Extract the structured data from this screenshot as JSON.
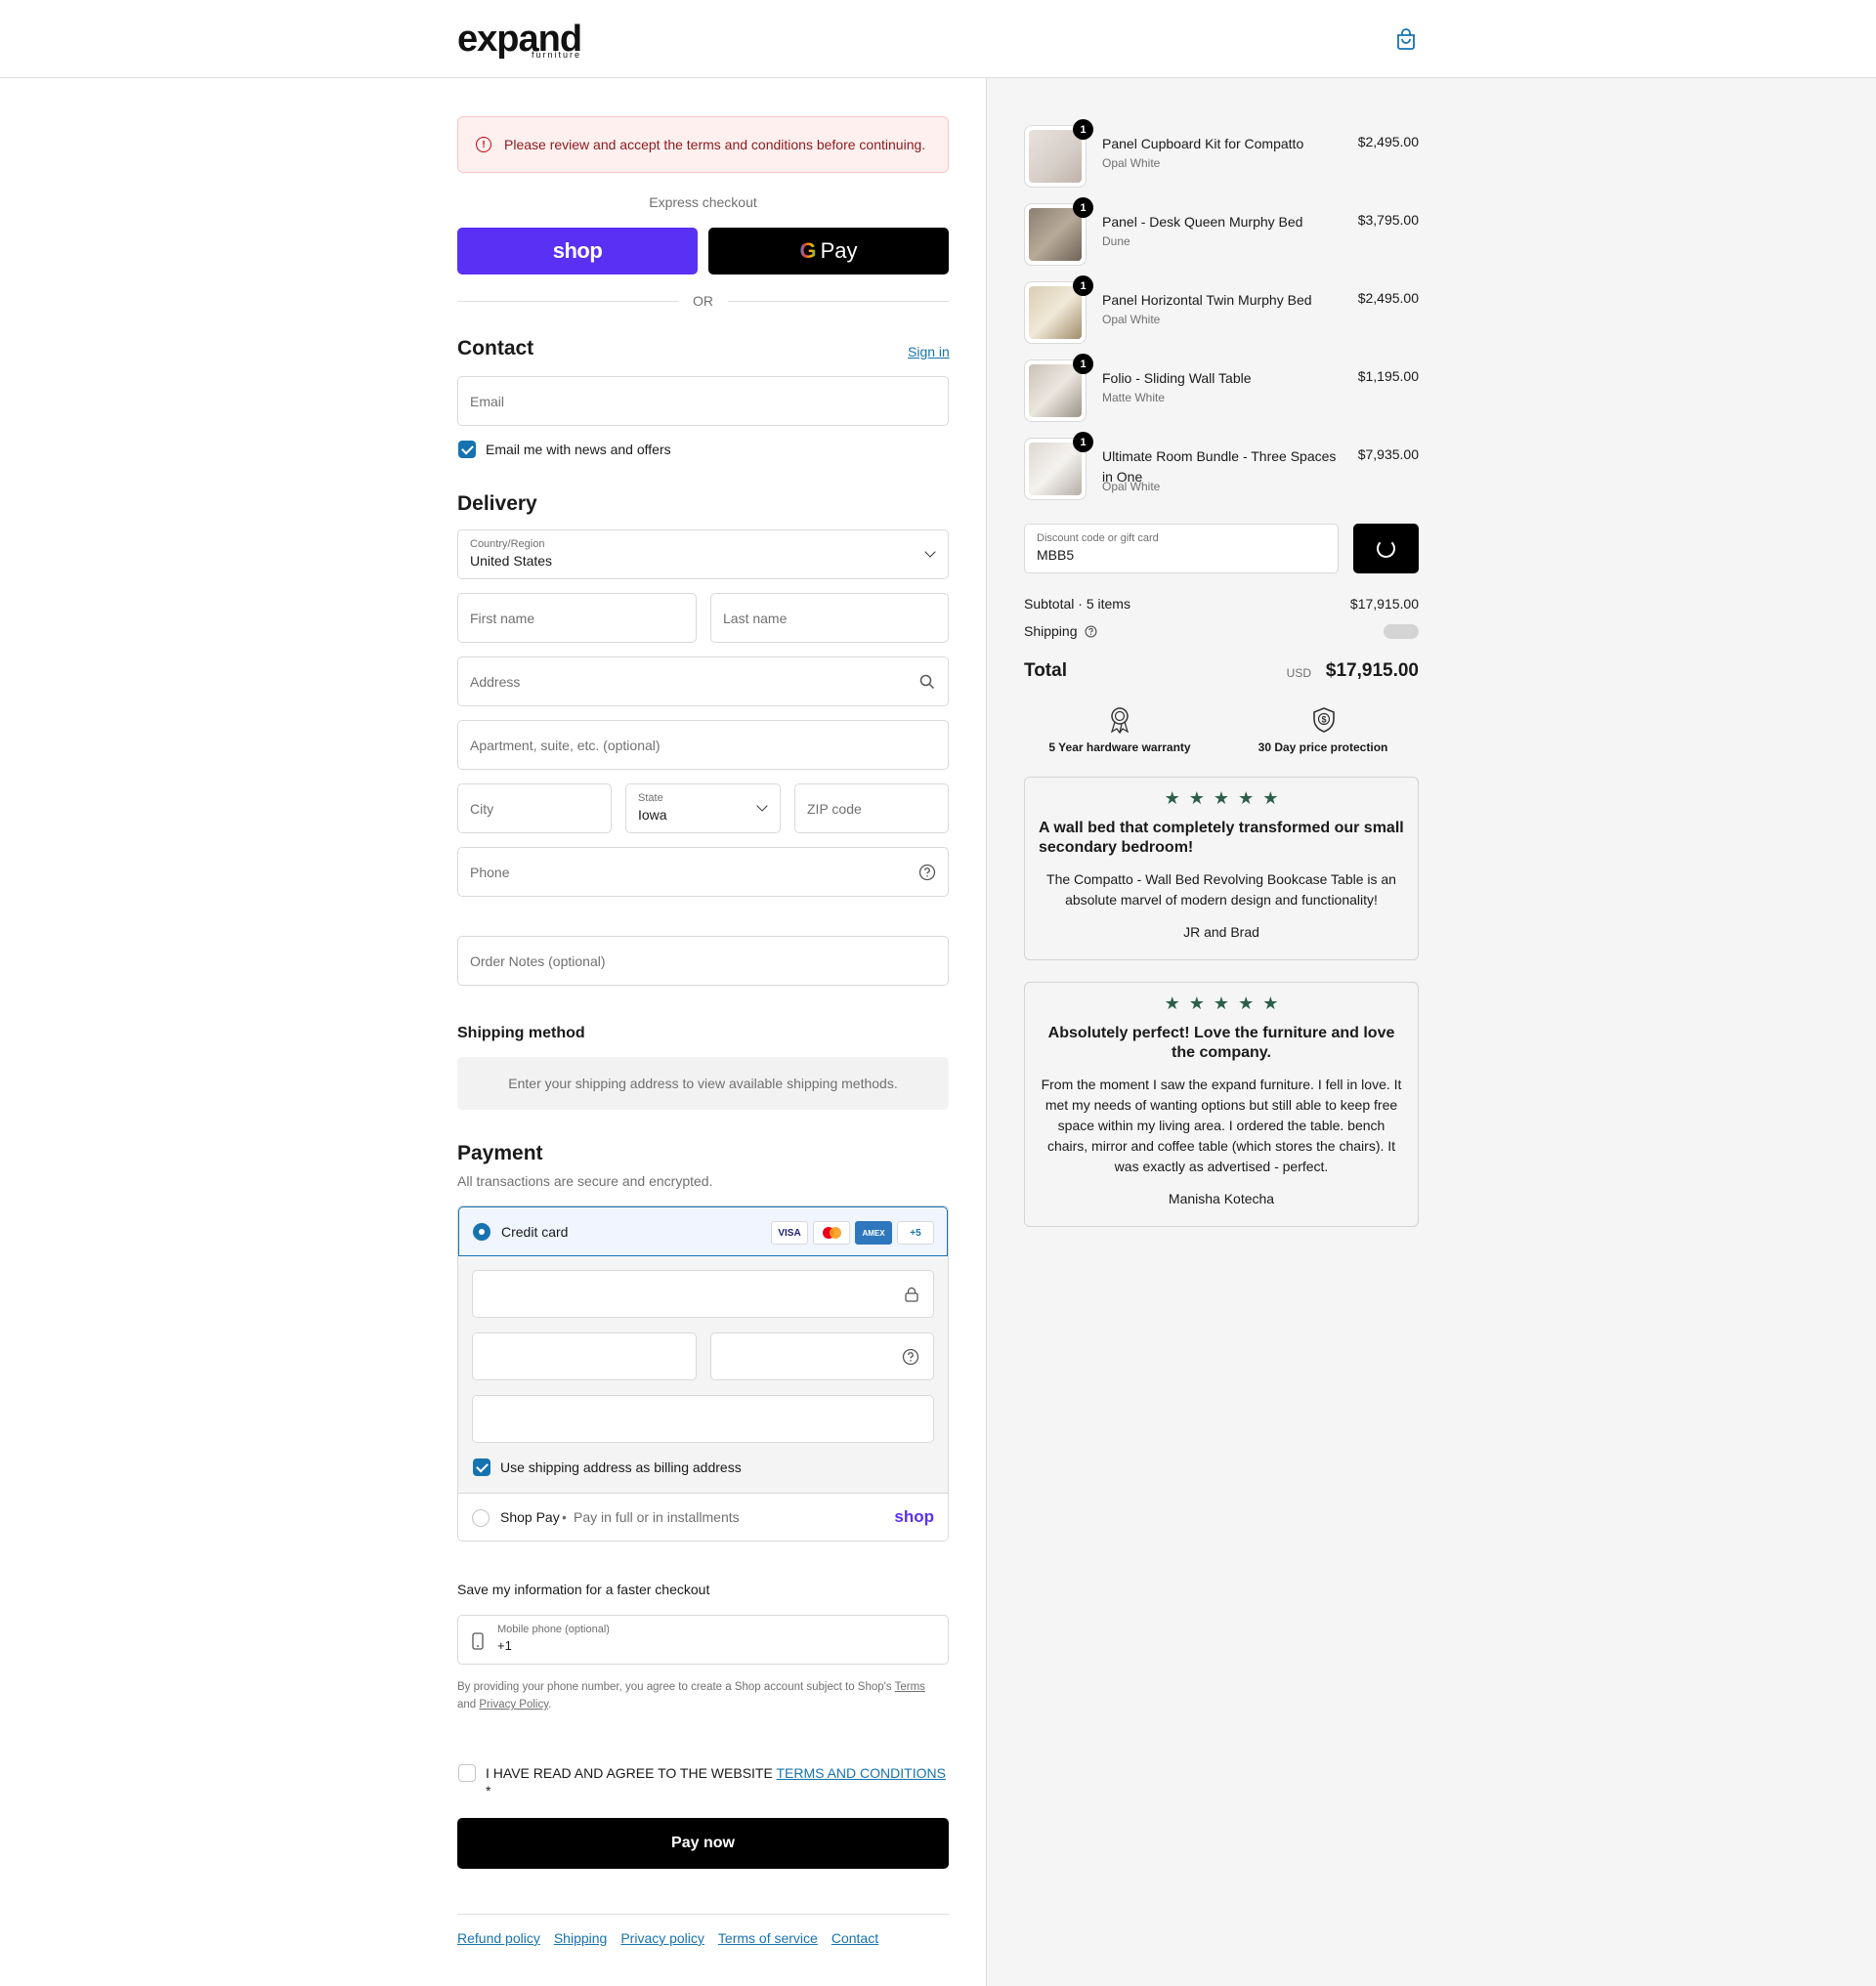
{
  "brand": {
    "logo_main": "expand",
    "logo_sub": "furniture"
  },
  "alert": {
    "icon": "alert-circle-icon",
    "text": "Please review and accept the terms and conditions before continuing."
  },
  "express": {
    "title": "Express checkout",
    "shop_label": "shop",
    "gpay_g": "G",
    "gpay_label": "Pay",
    "or": "OR"
  },
  "contact": {
    "title": "Contact",
    "signin": "Sign in",
    "email_placeholder": "Email",
    "news_label": "Email me with news and offers"
  },
  "delivery": {
    "title": "Delivery",
    "country_label": "Country/Region",
    "country_value": "United States",
    "first_name": "First name",
    "last_name": "Last name",
    "address": "Address",
    "apartment": "Apartment, suite, etc. (optional)",
    "city": "City",
    "state_label": "State",
    "state_value": "Iowa",
    "zip": "ZIP code",
    "phone": "Phone",
    "notes": "Order Notes (optional)"
  },
  "shipping_method": {
    "title": "Shipping method",
    "message": "Enter your shipping address to view available shipping methods."
  },
  "payment": {
    "title": "Payment",
    "subtitle": "All transactions are secure and encrypted.",
    "credit_card": "Credit card",
    "cards": [
      "VISA",
      "",
      "AMEX",
      "+5"
    ],
    "billing_label": "Use shipping address as billing address",
    "shop_pay": "Shop Pay",
    "shop_pay_sub": "Pay in full or in installments",
    "shop_logo": "shop"
  },
  "save_info": {
    "title": "Save my information for a faster checkout",
    "phone_label": "Mobile phone (optional)",
    "phone_value": "+1",
    "disclaimer_prefix": "By providing your phone number, you agree to create a Shop account subject to Shop's",
    "terms": "Terms",
    "and": "and",
    "privacy": "Privacy Policy",
    "period": "."
  },
  "terms": {
    "prefix": "I HAVE READ AND AGREE TO THE WEBSITE",
    "link": "TERMS AND CONDITIONS",
    "asterisk": "*"
  },
  "pay_now": "Pay now",
  "footer": [
    "Refund policy",
    "Shipping",
    "Privacy policy",
    "Terms of service",
    "Contact"
  ],
  "cart": {
    "items": [
      {
        "qty": "1",
        "name": "Panel Cupboard Kit for Compatto",
        "variant": "Opal White",
        "price": "$2,495.00"
      },
      {
        "qty": "1",
        "name": "Panel - Desk Queen Murphy Bed",
        "variant": "Dune",
        "price": "$3,795.00"
      },
      {
        "qty": "1",
        "name": "Panel Horizontal Twin Murphy Bed",
        "variant": "Opal White",
        "price": "$2,495.00"
      },
      {
        "qty": "1",
        "name": "Folio - Sliding Wall Table",
        "variant": "Matte White",
        "price": "$1,195.00"
      },
      {
        "qty": "1",
        "name": "Ultimate Room Bundle - Three Spaces in One",
        "variant": "Opal White",
        "price": "$7,935.00"
      }
    ],
    "discount_label": "Discount code or gift card",
    "discount_value": "MBB5",
    "subtotal_label": "Subtotal · 5 items",
    "subtotal_value": "$17,915.00",
    "shipping_label": "Shipping",
    "total_label": "Total",
    "currency": "USD",
    "total_value": "$17,915.00"
  },
  "features": [
    {
      "icon": "award-ribbon-icon",
      "label": "5 Year hardware warranty"
    },
    {
      "icon": "dollar-shield-icon",
      "label": "30 Day price protection"
    }
  ],
  "reviews": [
    {
      "stars": 5,
      "title": "A wall bed that completely transformed our small secondary bedroom!",
      "body": "The Compatto - Wall Bed Revolving Bookcase Table is an absolute marvel of modern design and functionality!",
      "author": "JR and Brad"
    },
    {
      "stars": 5,
      "title": "Absolutely perfect! Love the furniture and love the company.",
      "body": "From the moment I saw the expand furniture. I fell in love. It met my needs of wanting options but still able to keep free space within my living area. I ordered the table. bench chairs, mirror and coffee table (which stores the chairs). It was exactly as advertised - perfect.",
      "author": "Manisha Kotecha"
    }
  ],
  "colors": {
    "accent": "#1773b0",
    "shop_purple": "#5a31f4",
    "star_green": "#2c5f4a",
    "alert_bg": "#fff0f0"
  }
}
